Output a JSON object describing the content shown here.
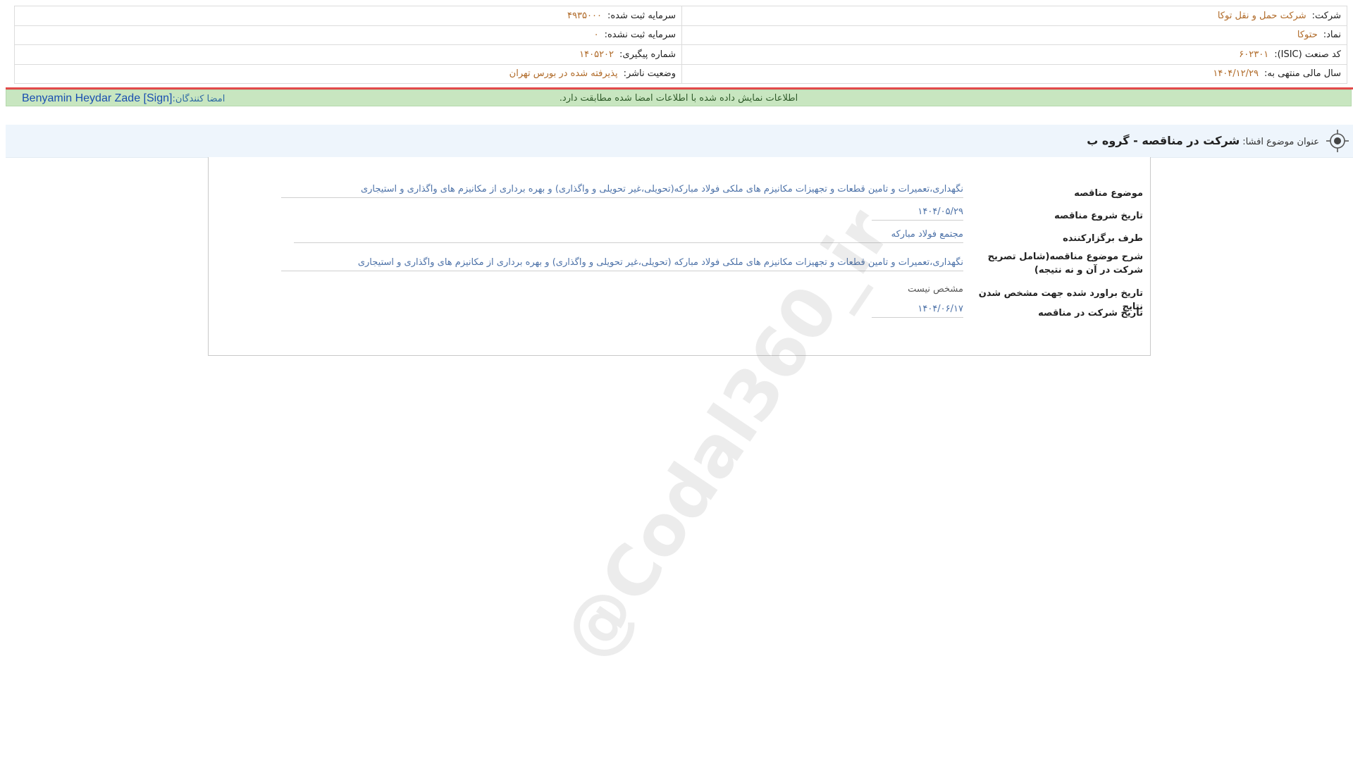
{
  "header": {
    "company_label": "شرکت:",
    "company_value": "شرکت حمل و نقل توکا",
    "symbol_label": "نماد:",
    "symbol_value": "حتوکا",
    "isic_label": "کد صنعت (ISIC):",
    "isic_value": "۶۰۲۳۰۱",
    "fiscal_label": "سال مالی منتهی به:",
    "fiscal_value": "۱۴۰۴/۱۲/۲۹",
    "registered_capital_label": "سرمایه ثبت شده:",
    "registered_capital_value": "۴۹۳۵۰۰۰",
    "unregistered_capital_label": "سرمایه ثبت نشده:",
    "unregistered_capital_value": "۰",
    "tracking_label": "شماره پیگیری:",
    "tracking_value": "۱۴۰۵۲۰۲",
    "publisher_status_label": "وضعیت ناشر:",
    "publisher_status_value": "پذیرفته شده در بورس تهران"
  },
  "verification": {
    "message": "اطلاعات نمایش داده شده با اطلاعات امضا شده مطابقت دارد.",
    "signers_label": "امضا کنندگان:",
    "signers_value": "Benyamin Heydar Zade [Sign]"
  },
  "disclosure": {
    "title_label": "عنوان موضوع افشا:",
    "title_value": "شرکت در مناقصه - گروه ب"
  },
  "tender": {
    "subject_label": "موضوع مناقصه",
    "subject_value": "نگهداری،تعمیرات و تامین قطعات و تجهیزات مکانیزم های ملکی فولاد مبارکه(تحویلی،غیر تحویلی و واگذاری) و بهره برداری از مکانیزم های واگذاری و استیجاری",
    "start_date_label": "تاریخ شروع مناقصه",
    "start_date_value": "۱۴۰۴/۰۵/۲۹",
    "organizer_label": "طرف برگزارکننده",
    "organizer_value": "مجتمع فولاد مبارکه",
    "description_label": "شرح موضوع مناقصه(شامل تصریح شرکت در آن و نه نتیجه)",
    "description_value": "نگهداری،تعمیرات و تامین قطعات و تجهیزات مکانیزم های ملکی فولاد مبارکه (تحویلی،غیر تحویلی و واگذاری) و بهره برداری از مکانیزم های واگذاری و استیجاری",
    "estimated_result_label": "تاریخ براورد شده جهت مشخص شدن نتایج",
    "estimated_result_value": "مشخص نیست",
    "participation_date_label": "تاریخ شرکت در مناقصه",
    "participation_date_value": "۱۴۰۴/۰۶/۱۷"
  },
  "watermark": "@Codal360_ir"
}
